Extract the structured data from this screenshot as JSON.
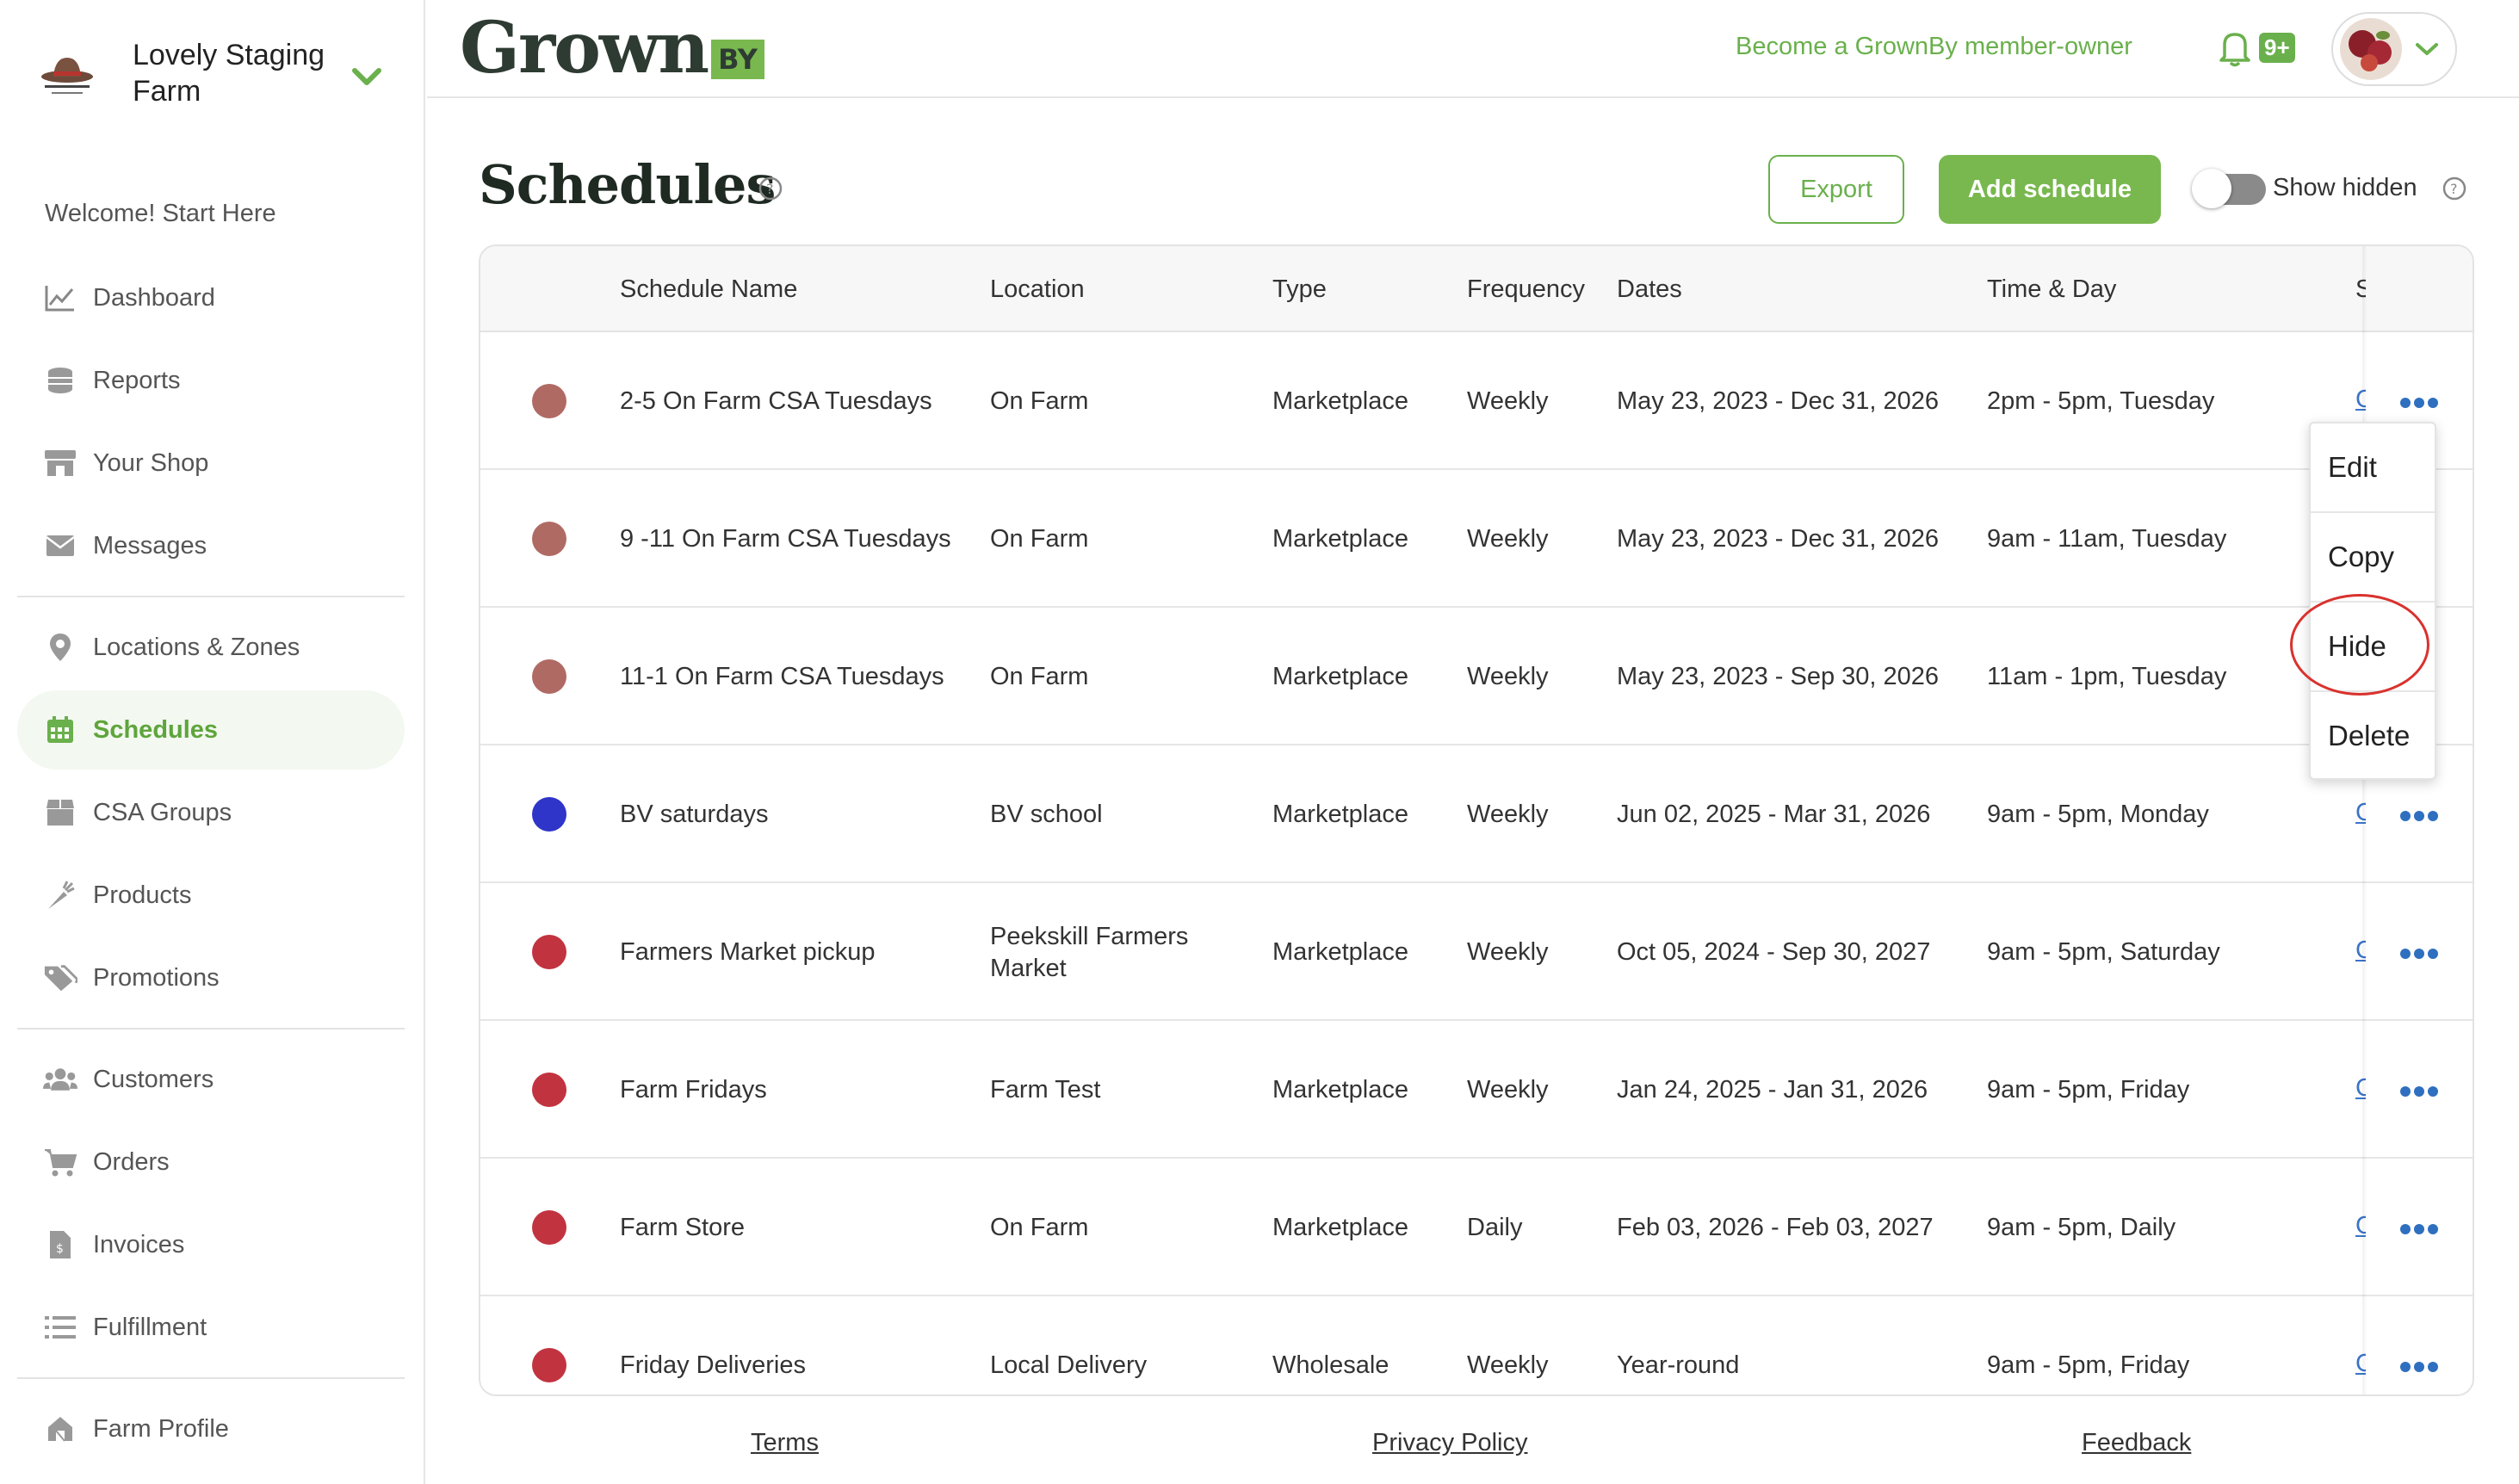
{
  "sidebar": {
    "farm_name": "Lovely Staging Farm",
    "welcome": "Welcome! Start Here",
    "items": [
      {
        "label": "Dashboard",
        "icon": "chart-icon"
      },
      {
        "label": "Reports",
        "icon": "coins-icon"
      },
      {
        "label": "Your Shop",
        "icon": "store-icon"
      },
      {
        "label": "Messages",
        "icon": "envelope-icon"
      },
      {
        "label": "Locations & Zones",
        "icon": "map-pin-icon"
      },
      {
        "label": "Schedules",
        "icon": "calendar-icon"
      },
      {
        "label": "CSA Groups",
        "icon": "box-icon"
      },
      {
        "label": "Products",
        "icon": "carrot-icon"
      },
      {
        "label": "Promotions",
        "icon": "tags-icon"
      },
      {
        "label": "Customers",
        "icon": "users-icon"
      },
      {
        "label": "Orders",
        "icon": "cart-icon"
      },
      {
        "label": "Invoices",
        "icon": "invoice-icon"
      },
      {
        "label": "Fulfillment",
        "icon": "list-icon"
      },
      {
        "label": "Farm Profile",
        "icon": "farm-icon"
      }
    ],
    "active": "Schedules"
  },
  "header": {
    "brand": "Grown",
    "brand_suffix": "BY",
    "member_link": "Become a GrownBy member-owner",
    "notification_badge": "9+"
  },
  "page": {
    "title": "Schedules",
    "export_label": "Export",
    "add_label": "Add schedule",
    "show_hidden_label": "Show hidden",
    "show_hidden_on": false
  },
  "table": {
    "columns": [
      "Schedule Name",
      "Location",
      "Type",
      "Frequency",
      "Dates",
      "Time & Day",
      "S"
    ],
    "rows": [
      {
        "name": "2-5 On Farm CSA Tuesdays",
        "location": "On Farm",
        "type": "Marketplace",
        "frequency": "Weekly",
        "dates": "May 23, 2023 - Dec 31, 2026",
        "time": "2pm - 5pm, Tuesday",
        "color": "#b06a64"
      },
      {
        "name": "9 -11 On Farm CSA Tuesdays",
        "location": "On Farm",
        "type": "Marketplace",
        "frequency": "Weekly",
        "dates": "May 23, 2023 - Dec 31, 2026",
        "time": "9am - 11am, Tuesday",
        "color": "#b06a64"
      },
      {
        "name": "11-1 On Farm CSA Tuesdays",
        "location": "On Farm",
        "type": "Marketplace",
        "frequency": "Weekly",
        "dates": "May 23, 2023 - Sep 30, 2026",
        "time": "11am - 1pm, Tuesday",
        "color": "#b06a64"
      },
      {
        "name": "BV saturdays",
        "location": "BV school",
        "type": "Marketplace",
        "frequency": "Weekly",
        "dates": "Jun 02, 2025 - Mar 31, 2026",
        "time": "9am - 5pm, Monday",
        "color": "#2f35c8"
      },
      {
        "name": "Farmers Market pickup",
        "location": "Peekskill Farmers Market",
        "type": "Marketplace",
        "frequency": "Weekly",
        "dates": "Oct 05, 2024 - Sep 30, 2027",
        "time": "9am - 5pm, Saturday",
        "color": "#c23340"
      },
      {
        "name": "Farm Fridays",
        "location": "Farm Test",
        "type": "Marketplace",
        "frequency": "Weekly",
        "dates": "Jan 24, 2025 - Jan 31, 2026",
        "time": "9am - 5pm, Friday",
        "color": "#c23340"
      },
      {
        "name": "Farm Store",
        "location": "On Farm",
        "type": "Marketplace",
        "frequency": "Daily",
        "dates": "Feb 03, 2026 - Feb 03, 2027",
        "time": "9am - 5pm, Daily",
        "color": "#c23340"
      },
      {
        "name": "Friday Deliveries",
        "location": "Local Delivery",
        "type": "Wholesale",
        "frequency": "Weekly",
        "dates": "Year-round",
        "time": "9am - 5pm, Friday",
        "color": "#c23340"
      }
    ],
    "truncated_link": "C"
  },
  "menu": {
    "items": [
      "Edit",
      "Copy",
      "Hide",
      "Delete"
    ]
  },
  "footer": {
    "terms": "Terms",
    "privacy": "Privacy Policy",
    "feedback": "Feedback"
  },
  "colors": {
    "accent": "#6ab04c",
    "annotation": "#d9322e",
    "link": "#3a73c8"
  }
}
